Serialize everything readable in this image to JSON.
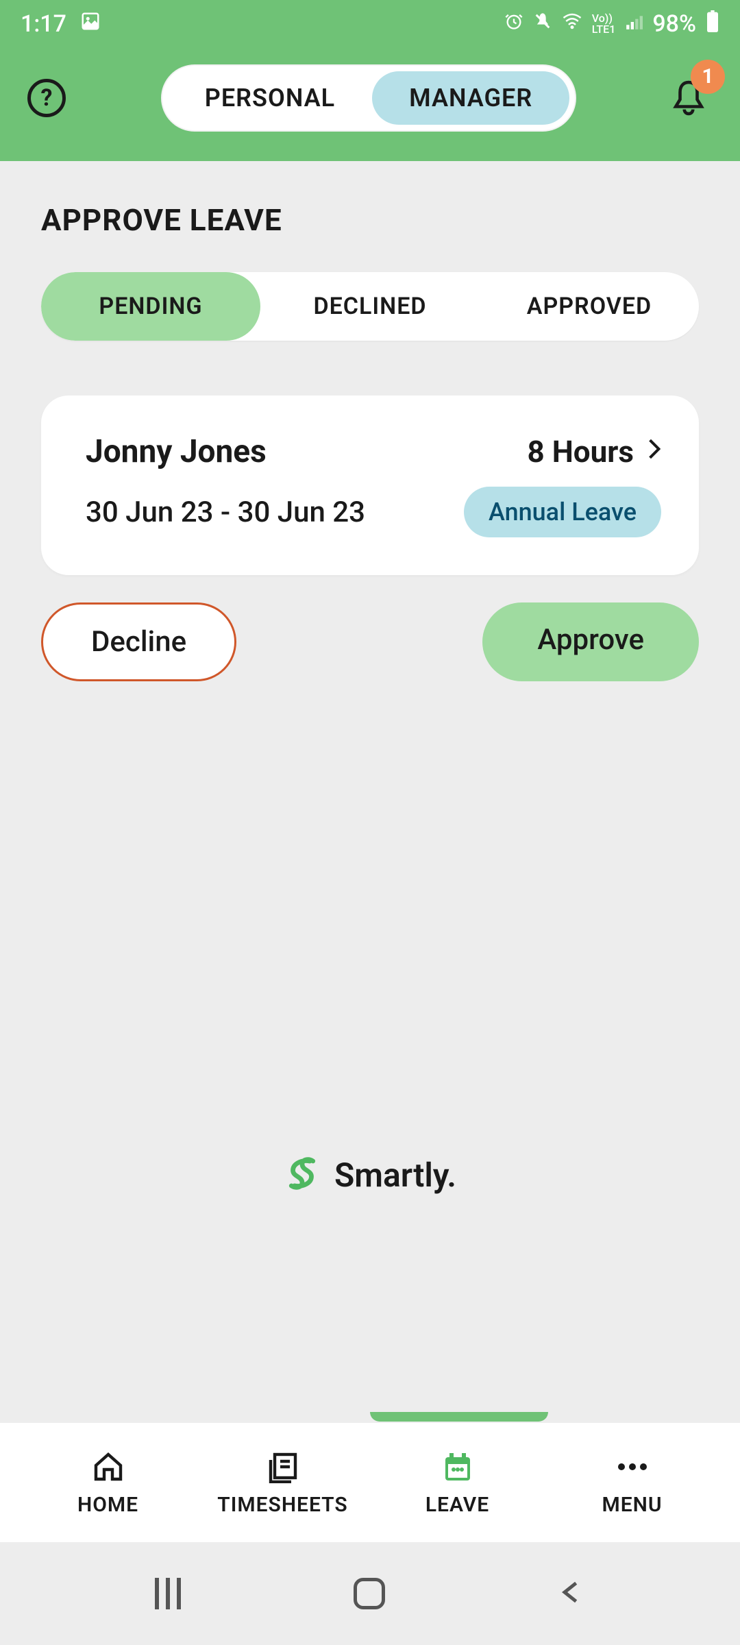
{
  "status_bar": {
    "time": "1:17",
    "battery": "98%",
    "network_label": "Vo))\nLTE1"
  },
  "header": {
    "role_toggle": {
      "personal": "PERSONAL",
      "manager": "MANAGER"
    },
    "notification_count": "1"
  },
  "page": {
    "title": "APPROVE LEAVE",
    "tabs": {
      "pending": "PENDING",
      "declined": "DECLINED",
      "approved": "APPROVED"
    }
  },
  "leave_request": {
    "name": "Jonny  Jones",
    "hours": "8 Hours",
    "dates": "30 Jun 23 - 30 Jun 23",
    "type": "Annual Leave"
  },
  "actions": {
    "decline": "Decline",
    "approve": "Approve"
  },
  "brand": "Smartly.",
  "bottom_nav": {
    "home": "HOME",
    "timesheets": "TIMESHEETS",
    "leave": "LEAVE",
    "menu": "MENU"
  }
}
